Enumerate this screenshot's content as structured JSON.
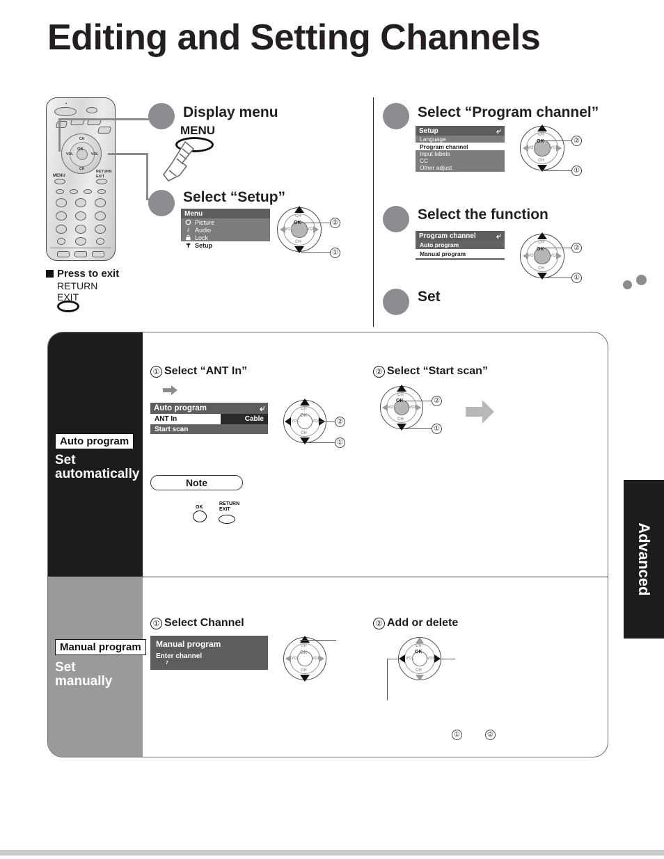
{
  "page": {
    "title": "Editing and Setting Channels",
    "section_tab": "Advanced"
  },
  "remote": {
    "labels": {
      "menu": "MENU",
      "ok": "OK",
      "ch_up": "CH",
      "ch_down": "CH",
      "vol_left": "VOL",
      "vol_right": "VOL",
      "return": "RETURN",
      "exit": "EXIT"
    }
  },
  "left_column": {
    "step1": {
      "heading": "Display menu",
      "button_label": "MENU"
    },
    "step2": {
      "heading": "Select “Setup”",
      "osd": {
        "title": "Menu",
        "rows": [
          {
            "icon": "circle-icon",
            "label": "Picture",
            "state": "normal"
          },
          {
            "icon": "note-icon",
            "label": "Audio",
            "state": "normal"
          },
          {
            "icon": "lock-icon",
            "label": "Lock",
            "state": "normal"
          },
          {
            "icon": "wrench-icon",
            "label": "Setup",
            "state": "selected"
          }
        ]
      },
      "callouts": {
        "one": "①",
        "two": "②"
      }
    },
    "exit_note": {
      "heading": "Press to exit",
      "line1": "RETURN",
      "line2": "EXIT"
    }
  },
  "right_column": {
    "step3": {
      "heading": "Select “Program channel”",
      "osd": {
        "title": "Setup",
        "back_icon": "return-arrow-icon",
        "rows": [
          {
            "label": "Language",
            "state": "normal"
          },
          {
            "label": "Program channel",
            "state": "selected"
          },
          {
            "label": "Input labels",
            "state": "normal"
          },
          {
            "label": "CC",
            "state": "normal"
          },
          {
            "label": "Other adjust",
            "state": "normal"
          }
        ]
      },
      "callouts": {
        "one": "①",
        "two": "②"
      }
    },
    "step4": {
      "heading": "Select the function",
      "osd": {
        "title": "Program channel",
        "back_icon": "return-arrow-icon",
        "rows": [
          {
            "label": "Auto program",
            "state": "highlighted"
          },
          {
            "label": "Manual program",
            "state": "selected"
          }
        ]
      },
      "callouts": {
        "one": "①",
        "two": "②"
      }
    },
    "step5": {
      "heading": "Set"
    }
  },
  "main_panel": {
    "auto": {
      "chip": "Auto program",
      "big_line1": "Set",
      "big_line2": "automatically",
      "sub1": {
        "num": "①",
        "text": "Select “ANT In”"
      },
      "osd": {
        "title": "Auto program",
        "back_icon": "return-arrow-icon",
        "rows": [
          {
            "label": "ANT In",
            "value": "Cable",
            "state": "selected"
          },
          {
            "label": "Start scan",
            "value": "",
            "state": "highlighted"
          }
        ]
      },
      "callouts": {
        "one": "①",
        "two": "②"
      },
      "sub2": {
        "num": "②",
        "text": "Select “Start scan”"
      },
      "callouts2": {
        "one": "①",
        "two": "②"
      },
      "note": {
        "label": "Note",
        "ok": "OK",
        "return": "RETURN",
        "exit": "EXIT"
      }
    },
    "manual": {
      "chip": "Manual program",
      "big_line1": "Set",
      "big_line2": "manually",
      "sub1": {
        "num": "①",
        "text": "Select Channel"
      },
      "osd": {
        "title": "Manual program",
        "field_label": "Enter channel",
        "field_value": "7"
      },
      "sub2": {
        "num": "②",
        "text": "Add or delete"
      },
      "footnotes": {
        "one": "①",
        "two": "②"
      }
    }
  },
  "nav_labels": {
    "ok": "OK",
    "ch": "CH",
    "vol": "VOL"
  }
}
